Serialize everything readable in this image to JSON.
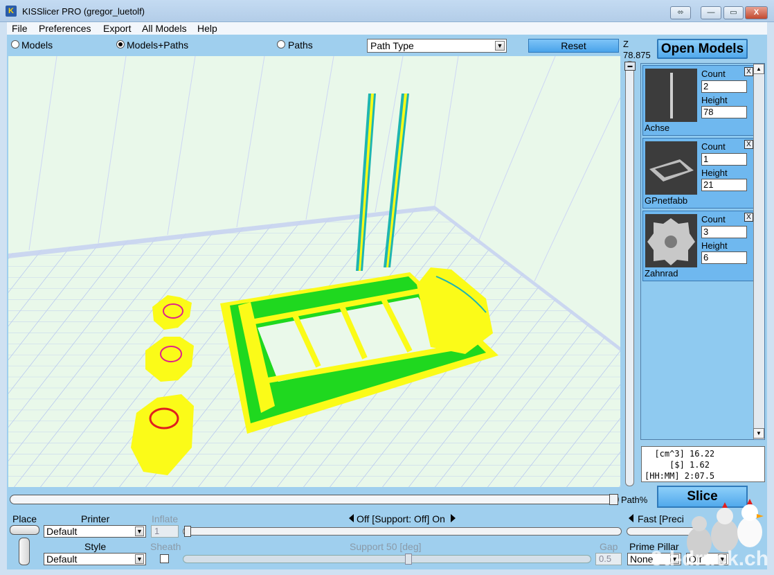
{
  "window": {
    "title": "KISSlicer PRO (gregor_luetolf)",
    "app_icon": "K",
    "restore_extra": "⬄",
    "minimize": "—",
    "maximize": "▭",
    "close": "X"
  },
  "menu": [
    "File",
    "Preferences",
    "Export",
    "All Models",
    "Help"
  ],
  "toolbar": {
    "view_modes": [
      {
        "label": "Models",
        "selected": false
      },
      {
        "label": "Models+Paths",
        "selected": true
      },
      {
        "label": "Paths",
        "selected": false
      }
    ],
    "path_type": "Path Type",
    "reset": "Reset",
    "z_label": "Z",
    "z_value": "78.875",
    "open_models": "Open Models"
  },
  "models": [
    {
      "name": "Achse",
      "count_label": "Count",
      "count": "2",
      "height_label": "Height",
      "height": "78",
      "remove": "X"
    },
    {
      "name": "GPnetfabb",
      "count_label": "Count",
      "count": "1",
      "height_label": "Height",
      "height": "21",
      "remove": "X"
    },
    {
      "name": "Zahnrad",
      "count_label": "Count",
      "count": "3",
      "height_label": "Height",
      "height": "6",
      "remove": "X"
    }
  ],
  "stats": {
    "volume": "  [cm^3] 16.22",
    "cost": "     [$] 1.62",
    "time": "[HH:MM] 2:07.5"
  },
  "path_pct_label": "Path%",
  "slice": "Slice",
  "bottom": {
    "place": "Place",
    "printer_label": "Printer",
    "printer_value": "Default",
    "inflate_label": "Inflate",
    "inflate_value": "1",
    "support_toggle": "Off [Support: Off] On",
    "speed_toggle": "Fast [Preci",
    "style_label": "Style",
    "style_value": "Default",
    "sheath_label": "Sheath",
    "support_angle_label": "Support 50 [deg]",
    "gap_label": "Gap",
    "gap_value": "0.5",
    "prime_pillar_label": "Prime Pillar",
    "prime_pillar_value": "None",
    "raft_value": "Off"
  },
  "watermark": "3d-druck.ch",
  "colors": {
    "accent": "#51a9ec",
    "frame": "#9fcfee",
    "viewport": "#e9f8ea",
    "path_green": "#22dd22",
    "path_yellow": "#ffff00",
    "path_cyan": "#22b8b8"
  }
}
